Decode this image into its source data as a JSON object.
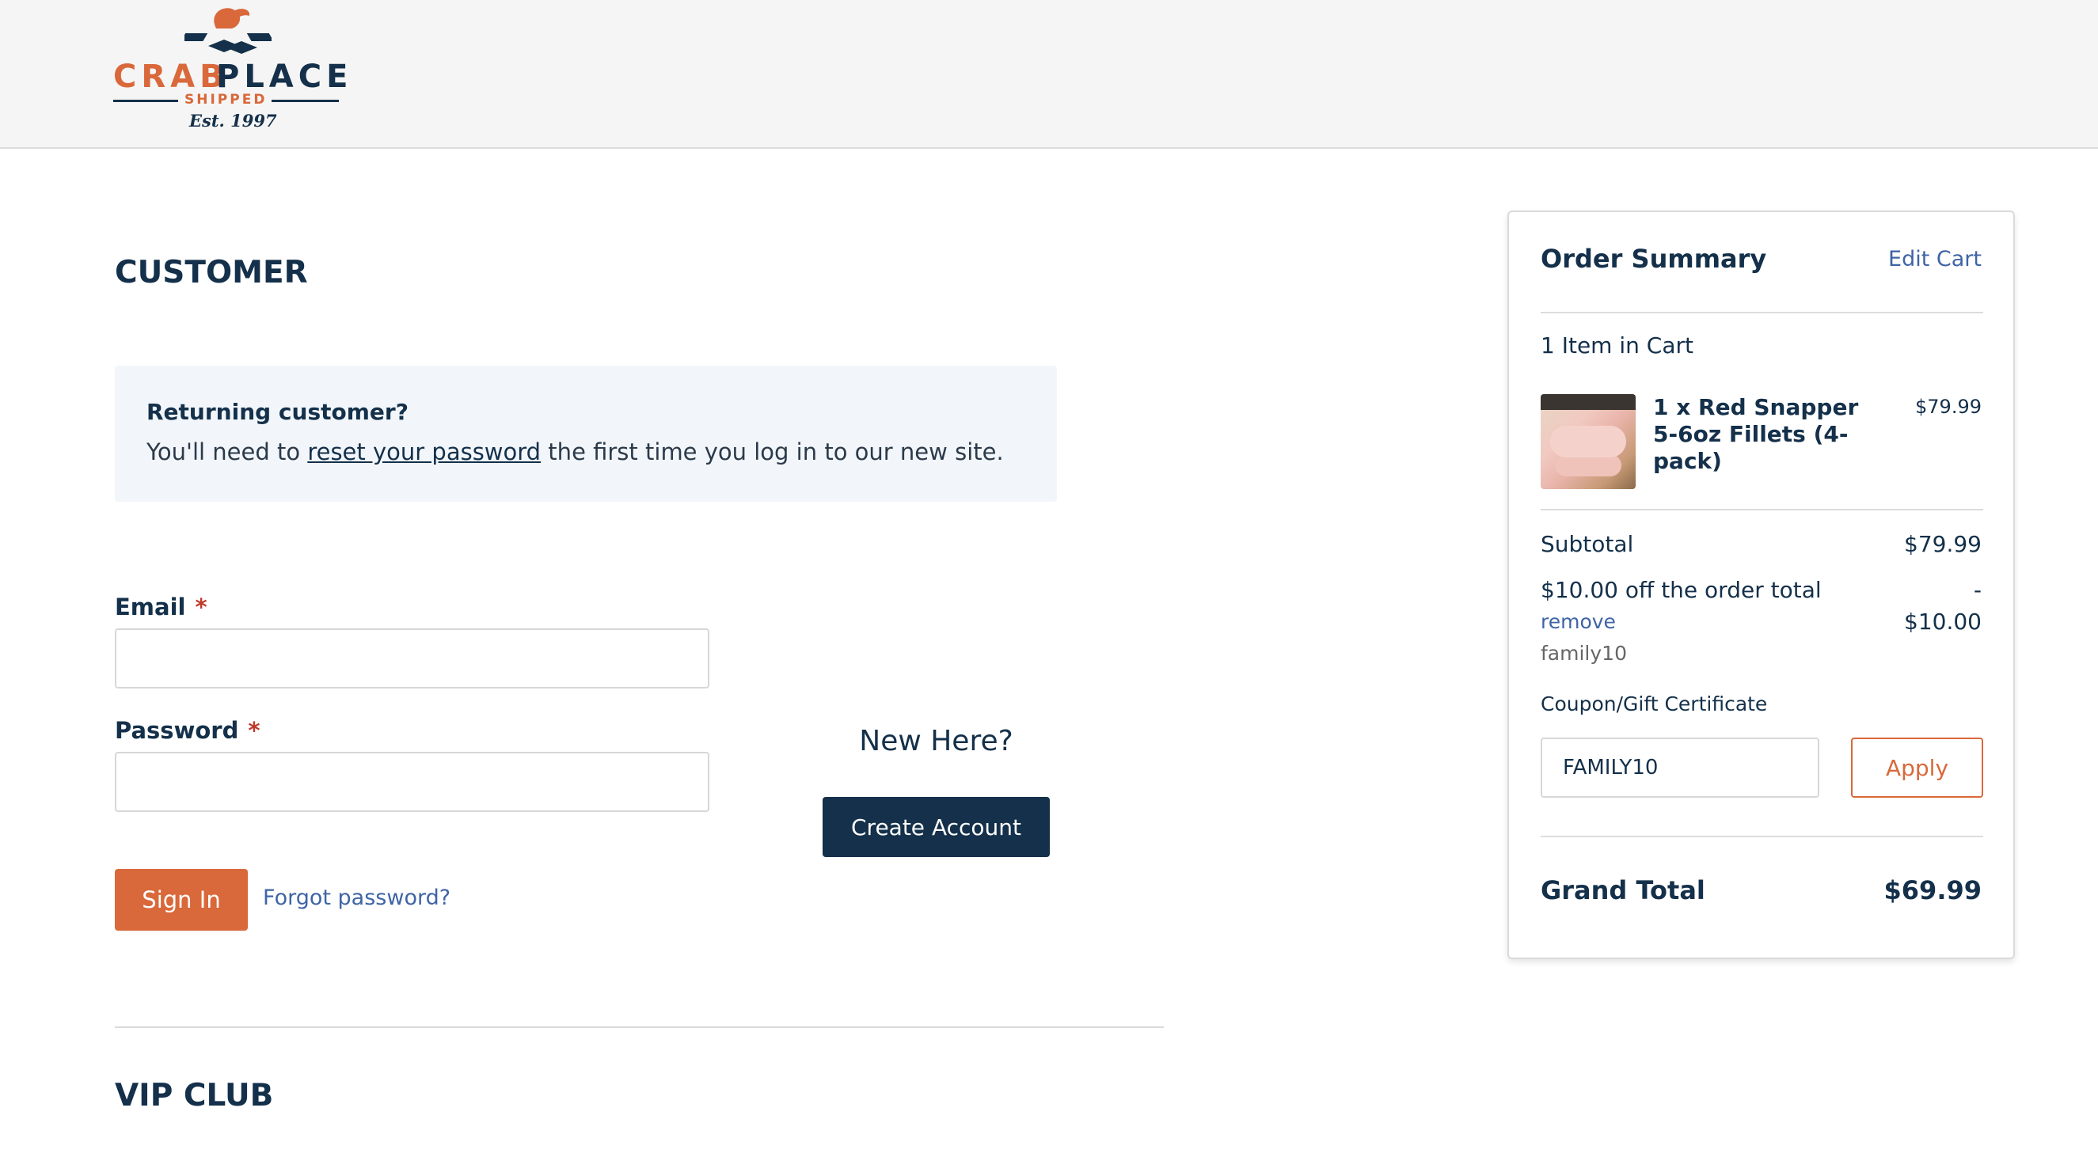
{
  "header": {
    "logo": {
      "word1": "CRAB",
      "word2": "PLACE",
      "tagline": "SHIPPED",
      "est": "Est. 1997"
    }
  },
  "customer": {
    "title": "CUSTOMER",
    "notice_title": "Returning customer?",
    "notice_text_before": "You'll need to ",
    "notice_link": "reset your password",
    "notice_text_after": " the first time you log in to our new site.",
    "email_label": "Email",
    "password_label": "Password",
    "required_mark": "*",
    "email_value": "",
    "password_value": "",
    "sign_in": "Sign In",
    "forgot": "Forgot password?",
    "new_here": "New Here?",
    "create_account": "Create Account",
    "vip_title": "VIP CLUB"
  },
  "summary": {
    "title": "Order Summary",
    "edit_cart": "Edit Cart",
    "item_count": "1 Item in Cart",
    "item": {
      "name": "1 x Red Snapper 5-6oz Fillets (4-pack)",
      "price": "$79.99"
    },
    "subtotal_label": "Subtotal",
    "subtotal_value": "$79.99",
    "discount_label": "$10.00 off the order total",
    "discount_dash": "-",
    "discount_value": "$10.00",
    "remove": "remove",
    "code": "family10",
    "coupon_label": "Coupon/Gift Certificate",
    "coupon_value": "FAMILY10",
    "apply": "Apply",
    "grand_total_label": "Grand Total",
    "grand_total_value": "$69.99"
  },
  "colors": {
    "navy": "#14304a",
    "accent_orange": "#d9683a",
    "link_blue": "#3f64a6"
  }
}
